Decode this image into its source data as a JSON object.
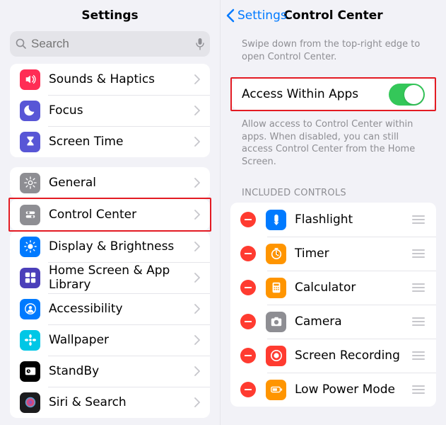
{
  "left": {
    "title": "Settings",
    "searchPlaceholder": "Search",
    "group1": [
      {
        "label": "Sounds & Haptics",
        "icon": "speaker",
        "bg": "#ff2d55"
      },
      {
        "label": "Focus",
        "icon": "moon",
        "bg": "#5856d6"
      },
      {
        "label": "Screen Time",
        "icon": "hourglass",
        "bg": "#5856d6"
      }
    ],
    "group2": [
      {
        "label": "General",
        "icon": "gear",
        "bg": "#8e8e93"
      },
      {
        "label": "Control Center",
        "icon": "sliders",
        "bg": "#8e8e93",
        "highlight": true
      },
      {
        "label": "Display & Brightness",
        "icon": "sun",
        "bg": "#007aff"
      },
      {
        "label": "Home Screen & App Library",
        "icon": "grid",
        "bg": "#4b3fba"
      },
      {
        "label": "Accessibility",
        "icon": "person",
        "bg": "#007aff"
      },
      {
        "label": "Wallpaper",
        "icon": "flower",
        "bg": "#00c7e6"
      },
      {
        "label": "StandBy",
        "icon": "clock",
        "bg": "#000"
      },
      {
        "label": "Siri & Search",
        "icon": "siri",
        "bg": "#1c1c1e"
      }
    ]
  },
  "right": {
    "back": "Settings",
    "title": "Control Center",
    "intro": "Swipe down from the top-right edge to open Control Center.",
    "accessLabel": "Access Within Apps",
    "accessOn": true,
    "accessDesc": "Allow access to Control Center within apps. When disabled, you can still access Control Center from the Home Screen.",
    "includedHeader": "INCLUDED CONTROLS",
    "controls": [
      {
        "label": "Flashlight",
        "icon": "flash",
        "bg": "#007aff"
      },
      {
        "label": "Timer",
        "icon": "timer",
        "bg": "#ff9500"
      },
      {
        "label": "Calculator",
        "icon": "calc",
        "bg": "#ff9500"
      },
      {
        "label": "Camera",
        "icon": "camera",
        "bg": "#8e8e93"
      },
      {
        "label": "Screen Recording",
        "icon": "rec",
        "bg": "#ff3b30"
      },
      {
        "label": "Low Power Mode",
        "icon": "battery",
        "bg": "#ff9500"
      }
    ]
  }
}
